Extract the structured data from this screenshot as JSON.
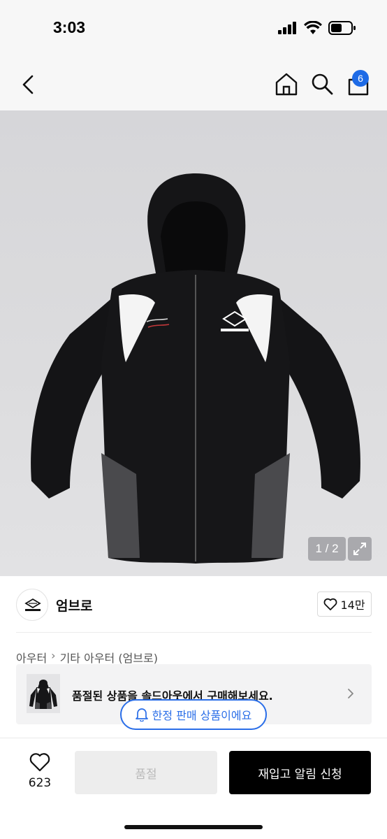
{
  "status": {
    "time": "3:03"
  },
  "nav": {
    "cart_count": "6"
  },
  "gallery": {
    "counter": "1 / 2"
  },
  "brand": {
    "name": "엄브로",
    "likes": "14만"
  },
  "breadcrumb": {
    "items": [
      "아우터",
      "기타 아우터 (엄브로)"
    ]
  },
  "soldout_banner": {
    "text": "품절된 상품을 솔드아웃에서 구매해보세요."
  },
  "limited": {
    "text": "한정 판매 상품이에요"
  },
  "bottom": {
    "wish_count": "623",
    "soldout_label": "품절",
    "restock_label": "재입고 알림 신청"
  },
  "colors": {
    "accent": "#2a6ee8",
    "badge": "#1e6be6",
    "primary_button": "#000000",
    "disabled_button": "#ededed"
  },
  "icons": [
    "back-icon",
    "home-icon",
    "search-icon",
    "cart-icon",
    "expand-icon",
    "heart-icon",
    "bell-icon",
    "chevron-right-icon"
  ]
}
